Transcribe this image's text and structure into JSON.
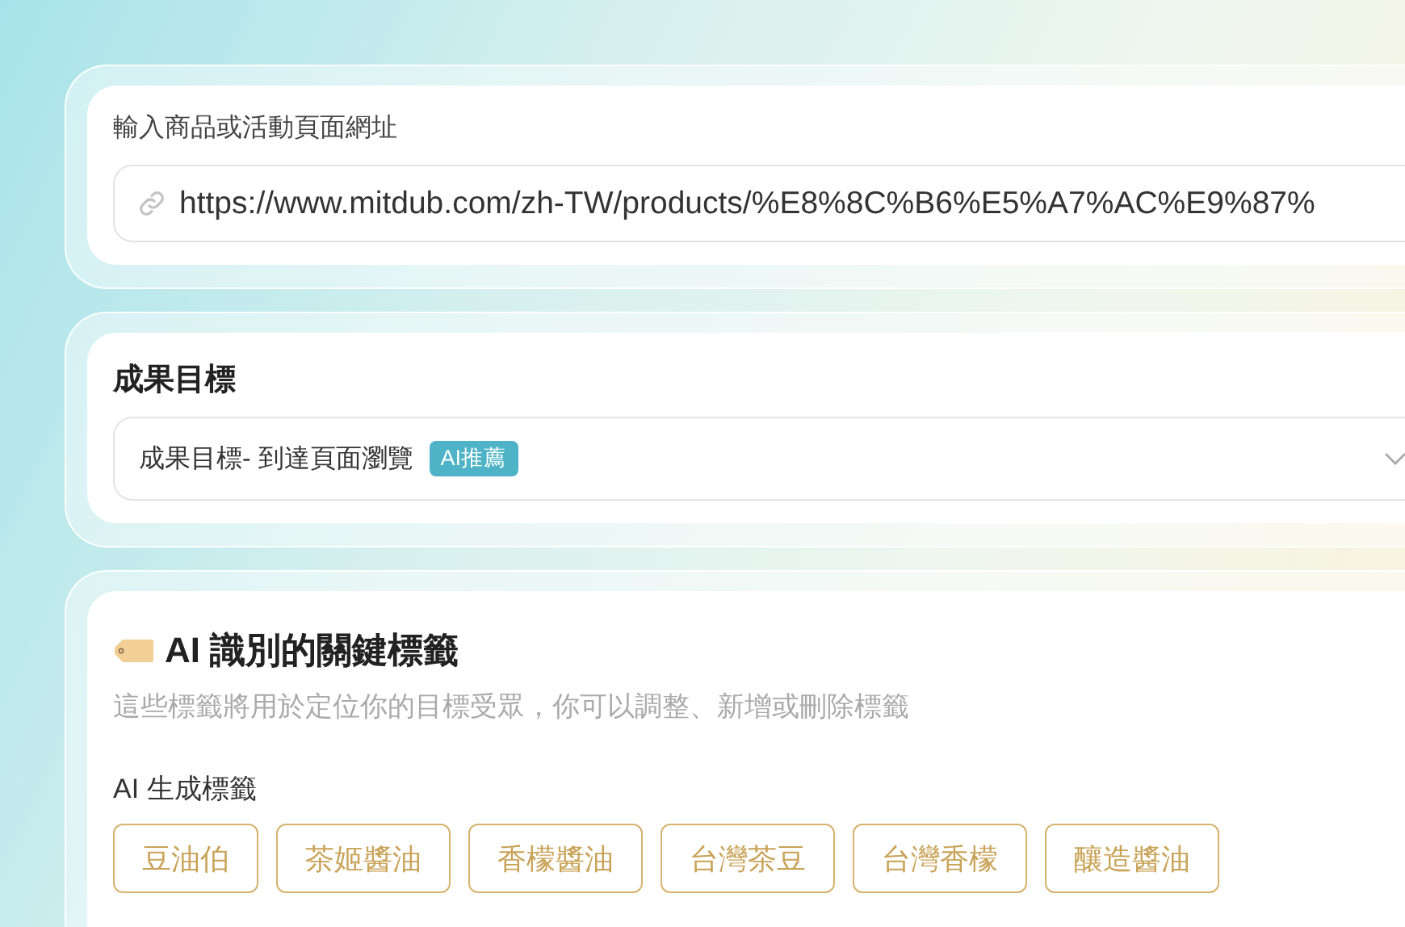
{
  "url_section": {
    "label": "輸入商品或活動頁面網址",
    "value": "https://www.mitdub.com/zh-TW/products/%E8%8C%B6%E5%A7%AC%E9%87%"
  },
  "goal_section": {
    "title": "成果目標",
    "selection": "成果目標- 到達頁面瀏覽",
    "badge": "AI推薦"
  },
  "tags_section": {
    "title": "AI 識別的關鍵標籤",
    "description": "這些標籤將用於定位你的目標受眾，你可以調整、新增或刪除標籤",
    "group_label": "AI 生成標籤",
    "tags": [
      {
        "label": "豆油伯"
      },
      {
        "label": "茶姬醬油"
      },
      {
        "label": "香檬醬油"
      },
      {
        "label": "台灣茶豆"
      },
      {
        "label": "台灣香檬"
      },
      {
        "label": "釀造醬油"
      }
    ]
  }
}
